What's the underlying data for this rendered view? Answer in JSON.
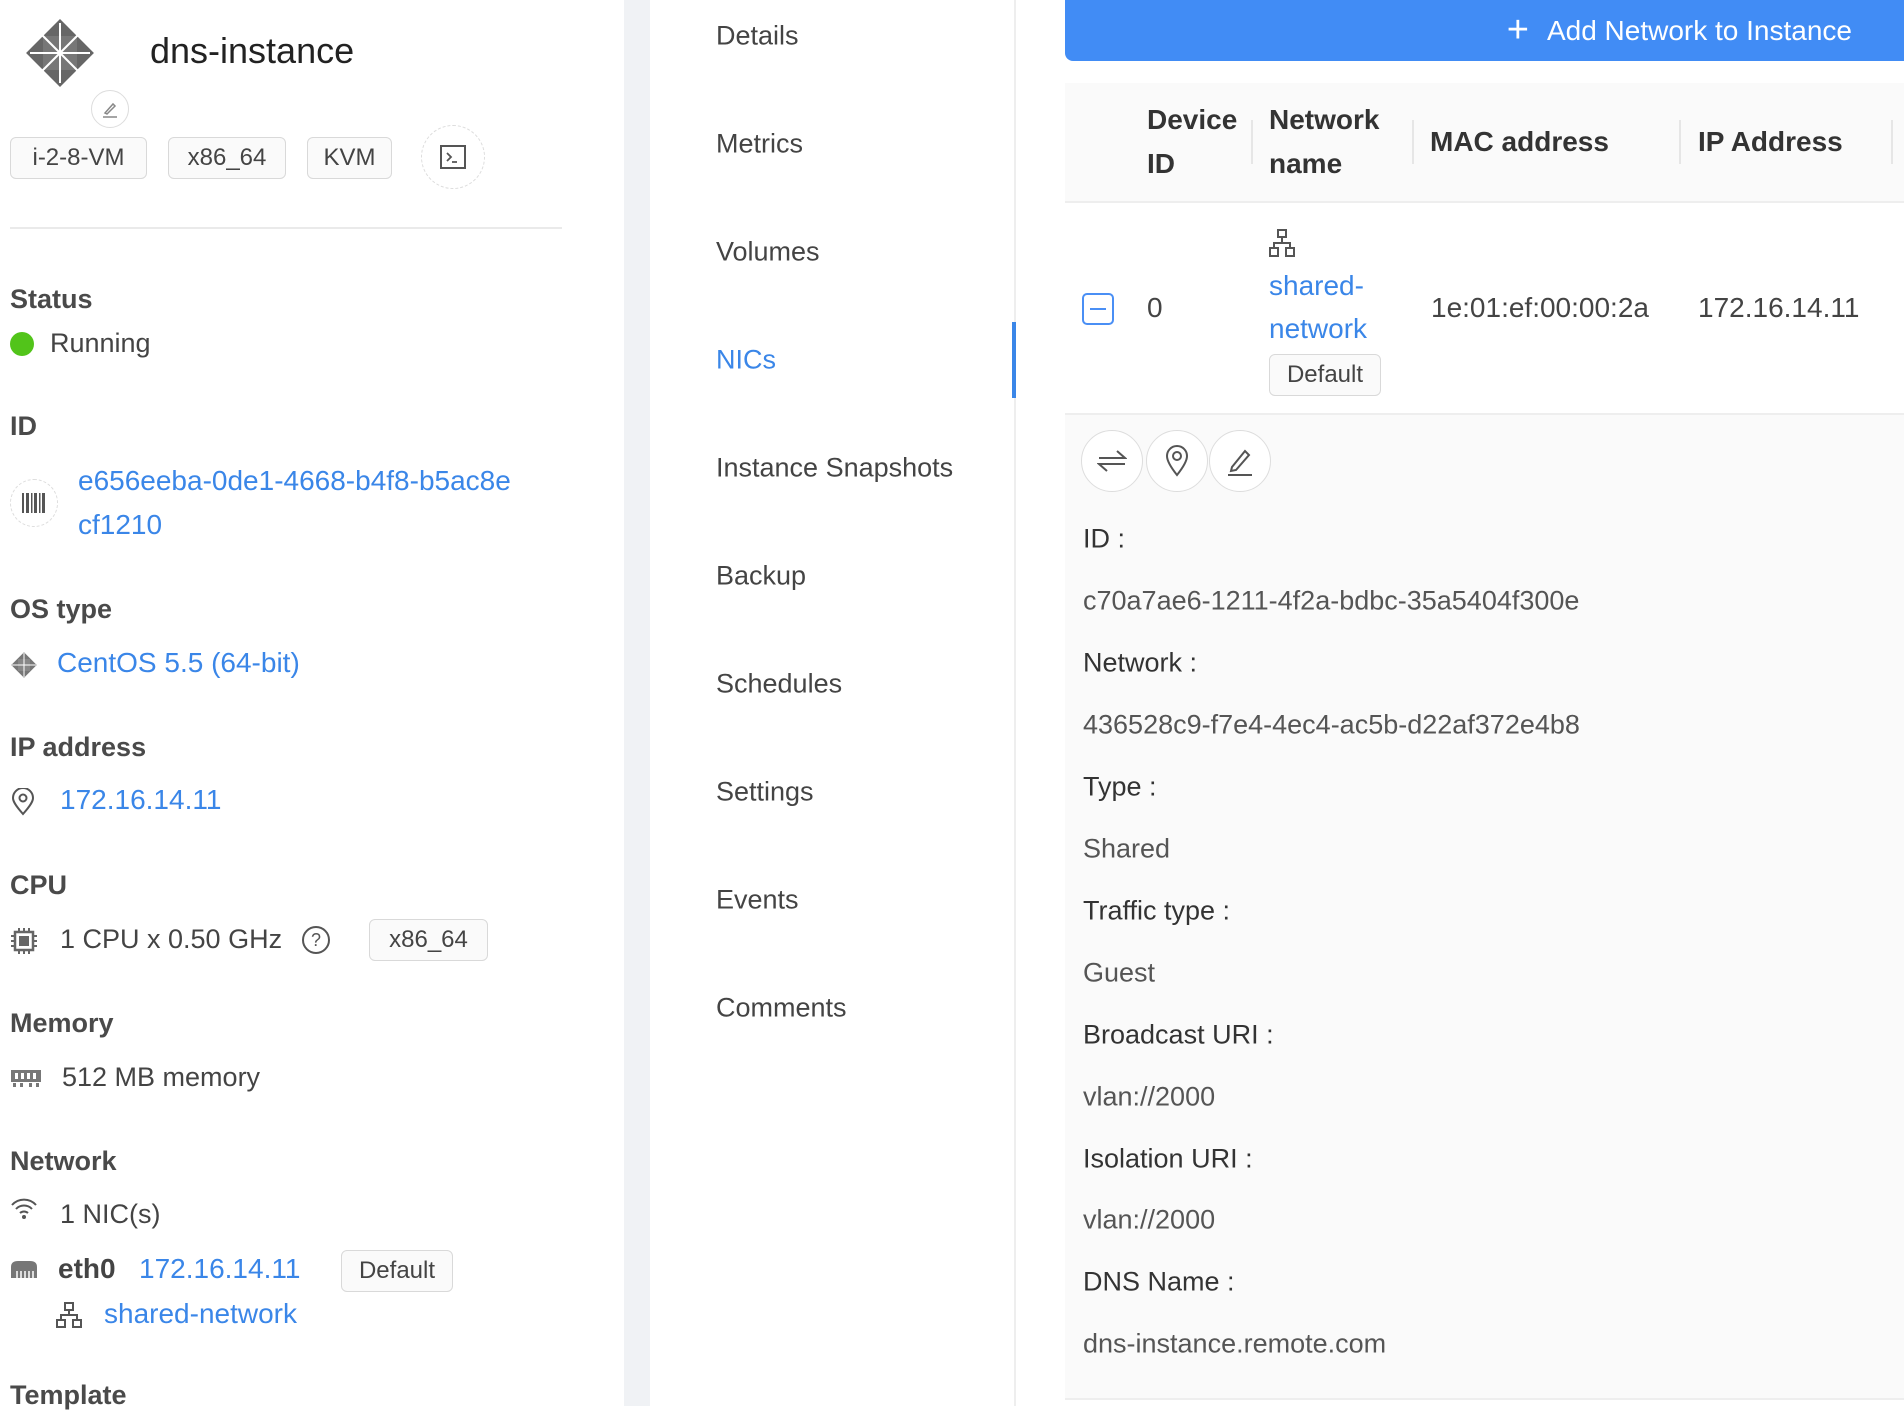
{
  "instance": {
    "name": "dns-instance",
    "tags": [
      "i-2-8-VM",
      "x86_64",
      "KVM"
    ],
    "status_label": "Status",
    "status": "Running",
    "status_color": "#52c41a",
    "id_label": "ID",
    "id_line1": "e656eeba-0de1-4668-b4f8-b5ac8e",
    "id_line2": "cf1210",
    "os_label": "OS type",
    "os": "CentOS 5.5 (64-bit)",
    "ip_label": "IP address",
    "ip": "172.16.14.11",
    "cpu_label": "CPU",
    "cpu": "1 CPU x 0.50 GHz",
    "cpu_arch": "x86_64",
    "memory_label": "Memory",
    "memory": "512 MB memory",
    "network_label": "Network",
    "nics": "1 NIC(s)",
    "nic_name": "eth0",
    "nic_ip": "172.16.14.11",
    "nic_default": "Default",
    "nic_network": "shared-network",
    "template_label": "Template"
  },
  "tabs": [
    "Details",
    "Metrics",
    "Volumes",
    "NICs",
    "Instance Snapshots",
    "Backup",
    "Schedules",
    "Settings",
    "Events",
    "Comments"
  ],
  "active_tab": "NICs",
  "add_button": "Add Network to Instance",
  "table": {
    "headers": {
      "device_id_1": "Device",
      "device_id_2": "ID",
      "network_name_1": "Network",
      "network_name_2": "name",
      "mac": "MAC address",
      "ip": "IP Address"
    },
    "row": {
      "device_id": "0",
      "network_1": "shared-",
      "network_2": "network",
      "default": "Default",
      "mac": "1e:01:ef:00:00:2a",
      "ip": "172.16.14.11"
    }
  },
  "details": [
    {
      "k": "ID :",
      "v": "c70a7ae6-1211-4f2a-bdbc-35a5404f300e"
    },
    {
      "k": "Network :",
      "v": "436528c9-f7e4-4ec4-ac5b-d22af372e4b8"
    },
    {
      "k": "Type :",
      "v": "Shared"
    },
    {
      "k": "Traffic type :",
      "v": "Guest"
    },
    {
      "k": "Broadcast URI :",
      "v": "vlan://2000"
    },
    {
      "k": "Isolation URI :",
      "v": "vlan://2000"
    },
    {
      "k": "DNS Name :",
      "v": "dns-instance.remote.com"
    }
  ]
}
